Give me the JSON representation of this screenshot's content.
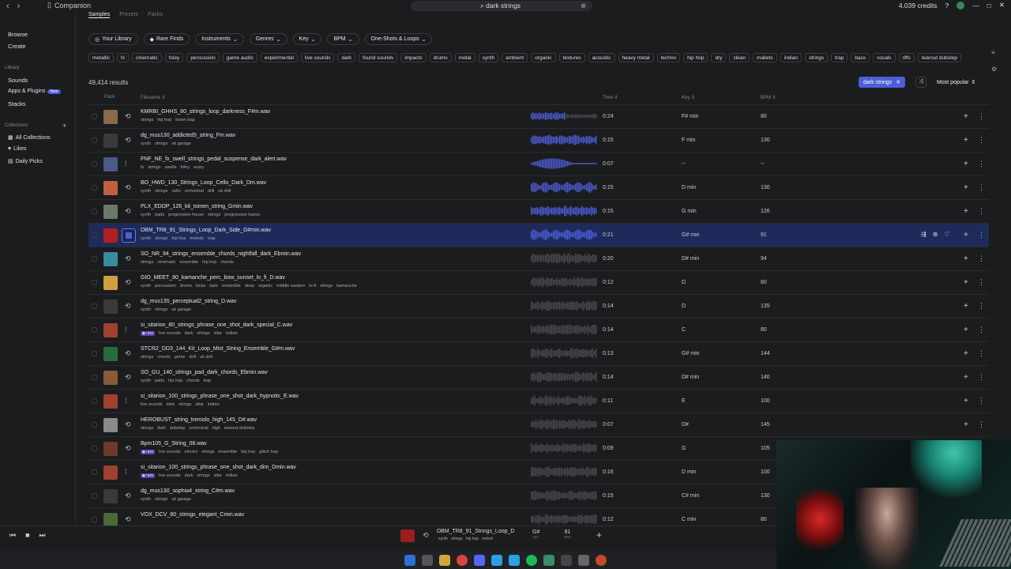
{
  "titlebar": {
    "app": "Companion",
    "search": "dark strings",
    "credits": "4.039 credits"
  },
  "sidebar": {
    "browse": "Browse",
    "create": "Create",
    "library_head": "Library",
    "sounds": "Sounds",
    "apps": "Apps & Plugins",
    "apps_badge": "New",
    "stacks": "Stacks",
    "collections_head": "Collections",
    "all_collections": "All Collections",
    "likes": "Likes",
    "daily_picks": "Daily Picks"
  },
  "tabs": [
    "Samples",
    "Presets",
    "Packs"
  ],
  "filters": [
    "Your Library",
    "Rare Finds",
    "Instruments",
    "Genres",
    "Key",
    "BPM",
    "One-Shots & Loops"
  ],
  "tags": [
    "metallic",
    "fx",
    "cinematic",
    "foley",
    "percussion",
    "game audio",
    "experimental",
    "live sounds",
    "dark",
    "found sounds",
    "impacts",
    "drums",
    "metal",
    "synth",
    "ambient",
    "organic",
    "textures",
    "acoustic",
    "heavy metal",
    "techno",
    "hip hop",
    "dry",
    "clean",
    "mallets",
    "indian",
    "strings",
    "trap",
    "bass",
    "vocals",
    "riffs",
    "tearout dubstep"
  ],
  "results": "49,414 results",
  "active_chip": "dark strings",
  "sort": "Most popular",
  "headers": {
    "pack": "Pack",
    "filename": "Filename",
    "time": "Time",
    "key": "Key",
    "bpm": "BPM"
  },
  "rows": [
    {
      "name": "KMRBI_GHHS_80_strings_loop_darkness_F#m.wav",
      "tags": [
        "strings",
        "hip hop",
        "boom bap"
      ],
      "time": "0:24",
      "key": "F# min",
      "bpm": "80",
      "type": "loop",
      "color": "#8a6a4a",
      "wave": "blue-short"
    },
    {
      "name": "dg_mus130_addicted5_string_Fm.wav",
      "tags": [
        "synth",
        "strings",
        "uk garage"
      ],
      "time": "0:15",
      "key": "F min",
      "bpm": "130",
      "type": "loop",
      "color": "#3a3a3a",
      "wave": "blue-full"
    },
    {
      "name": "FNF_NE_fx_swell_strings_pedal_suspense_dark_alert.wav",
      "tags": [
        "fx",
        "strings",
        "swells",
        "foley",
        "scary"
      ],
      "time": "0:07",
      "key": "--",
      "bpm": "--",
      "type": "oneshot",
      "color": "#4a5a8a",
      "wave": "blue-swell"
    },
    {
      "name": "BO_HWD_130_Strings_Loop_Cello_Dark_Dm.wav",
      "tags": [
        "synth",
        "strings",
        "cello",
        "orchestral",
        "drill",
        "uk drill"
      ],
      "time": "0:15",
      "key": "D min",
      "bpm": "130",
      "type": "loop",
      "color": "#c06040",
      "wave": "blue-pulse"
    },
    {
      "name": "PLX_EDDP_126_kit_toinen_string_Gmin.wav",
      "tags": [
        "synth",
        "pads",
        "progressive house",
        "strings",
        "progressive trance"
      ],
      "time": "0:15",
      "key": "G min",
      "bpm": "126",
      "type": "loop",
      "color": "#6a7a6a",
      "wave": "blue-full"
    },
    {
      "name": "DBM_TR8_91_Strings_Loop_Dark_Side_G#min.wav",
      "tags": [
        "synth",
        "strings",
        "hip hop",
        "melody",
        "trap"
      ],
      "time": "0:21",
      "key": "G# min",
      "bpm": "91",
      "type": "loop",
      "color": "#b02020",
      "wave": "blue-pulse",
      "selected": true
    },
    {
      "name": "SO_NR_94_strings_ensemble_chords_nightfall_dark_Ebmin.wav",
      "tags": [
        "strings",
        "cinematic",
        "ensemble",
        "hip hop",
        "chords"
      ],
      "time": "0:20",
      "key": "D# min",
      "bpm": "94",
      "type": "loop",
      "color": "#3a8aa0",
      "wave": "grey"
    },
    {
      "name": "GIO_MEET_80_kamanche_perc_bow_sunset_lo_fi_D.wav",
      "tags": [
        "synth",
        "percussion",
        "drums",
        "kicks",
        "dark",
        "ensemble",
        "deep",
        "organic",
        "middle eastern",
        "lo-fi",
        "strings",
        "kamanche"
      ],
      "time": "0:12",
      "key": "D",
      "bpm": "80",
      "type": "loop",
      "color": "#d0a040",
      "wave": "grey"
    },
    {
      "name": "dg_mus135_perceptual2_string_D.wav",
      "tags": [
        "synth",
        "strings",
        "uk garage"
      ],
      "time": "0:14",
      "key": "D",
      "bpm": "135",
      "type": "loop",
      "color": "#3a3a3a",
      "wave": "grey"
    },
    {
      "name": "si_sitarion_80_strings_phrase_one_shot_dark_special_C.wav",
      "tags": [
        "live sounds",
        "dark",
        "strings",
        "sitar",
        "indian"
      ],
      "rare": true,
      "time": "0:14",
      "key": "C",
      "bpm": "80",
      "type": "oneshot",
      "color": "#a04030",
      "wave": "grey"
    },
    {
      "name": "STCR2_DD3_144_Kit_Loop_Mist_String_Ensemble_G#m.wav",
      "tags": [
        "strings",
        "chords",
        "grime",
        "drill",
        "uk drill"
      ],
      "time": "0:13",
      "key": "G# min",
      "bpm": "144",
      "type": "loop",
      "color": "#2a6a3a",
      "wave": "grey"
    },
    {
      "name": "SO_GU_140_strings_pad_dark_chords_Ebmin.wav",
      "tags": [
        "synth",
        "pads",
        "hip hop",
        "chords",
        "trap"
      ],
      "time": "0:14",
      "key": "D# min",
      "bpm": "140",
      "type": "loop",
      "color": "#8a5a3a",
      "wave": "grey"
    },
    {
      "name": "si_sitarion_100_strings_phrase_one_shot_dark_hypnotic_E.wav",
      "tags": [
        "live sounds",
        "dark",
        "strings",
        "sitar",
        "indian"
      ],
      "time": "0:11",
      "key": "E",
      "bpm": "100",
      "type": "oneshot",
      "color": "#a04030",
      "wave": "grey"
    },
    {
      "name": "HEROBUST_string_tremolo_high_145_D#.wav",
      "tags": [
        "strings",
        "dark",
        "dubstep",
        "orchestral",
        "high",
        "tearout dubstep"
      ],
      "time": "0:07",
      "key": "D#",
      "bpm": "145",
      "type": "loop",
      "color": "#8a8a8a",
      "wave": "grey"
    },
    {
      "name": "Bpm105_G_String_08.wav",
      "tags": [
        "live sounds",
        "electro",
        "strings",
        "ensemble",
        "hip hop",
        "glitch hop"
      ],
      "rare": true,
      "time": "0:09",
      "key": "G",
      "bpm": "105",
      "type": "loop",
      "color": "#6a3a2a",
      "wave": "grey"
    },
    {
      "name": "si_sitarion_100_strings_phrase_one_shot_dark_dim_Dmin.wav",
      "tags": [
        "live sounds",
        "dark",
        "strings",
        "sitar",
        "indian"
      ],
      "rare": true,
      "time": "0:16",
      "key": "D min",
      "bpm": "100",
      "type": "oneshot",
      "color": "#a04030",
      "wave": "grey"
    },
    {
      "name": "dg_mus130_sophia4_string_C#m.wav",
      "tags": [
        "synth",
        "strings",
        "uk garage"
      ],
      "time": "0:15",
      "key": "C# min",
      "bpm": "130",
      "type": "loop",
      "color": "#3a3a3a",
      "wave": "grey"
    },
    {
      "name": "VOX_DCV_80_strings_elegant_Cmin.wav",
      "tags": [],
      "time": "0:12",
      "key": "C min",
      "bpm": "80",
      "type": "loop",
      "color": "#4a6a3a",
      "wave": "grey"
    }
  ],
  "player": {
    "name": "DBM_TR8_91_Strings_Loop_D",
    "tags": [
      "synth",
      "strings",
      "hip hop",
      "melod"
    ],
    "key": "G#",
    "key_label": "KEY",
    "bpm": "91",
    "bpm_label": "BPM"
  },
  "colors": {
    "accent": "#4d5ed9",
    "selected_row": "#1e2a5a",
    "rare": "#5b3fb0"
  }
}
